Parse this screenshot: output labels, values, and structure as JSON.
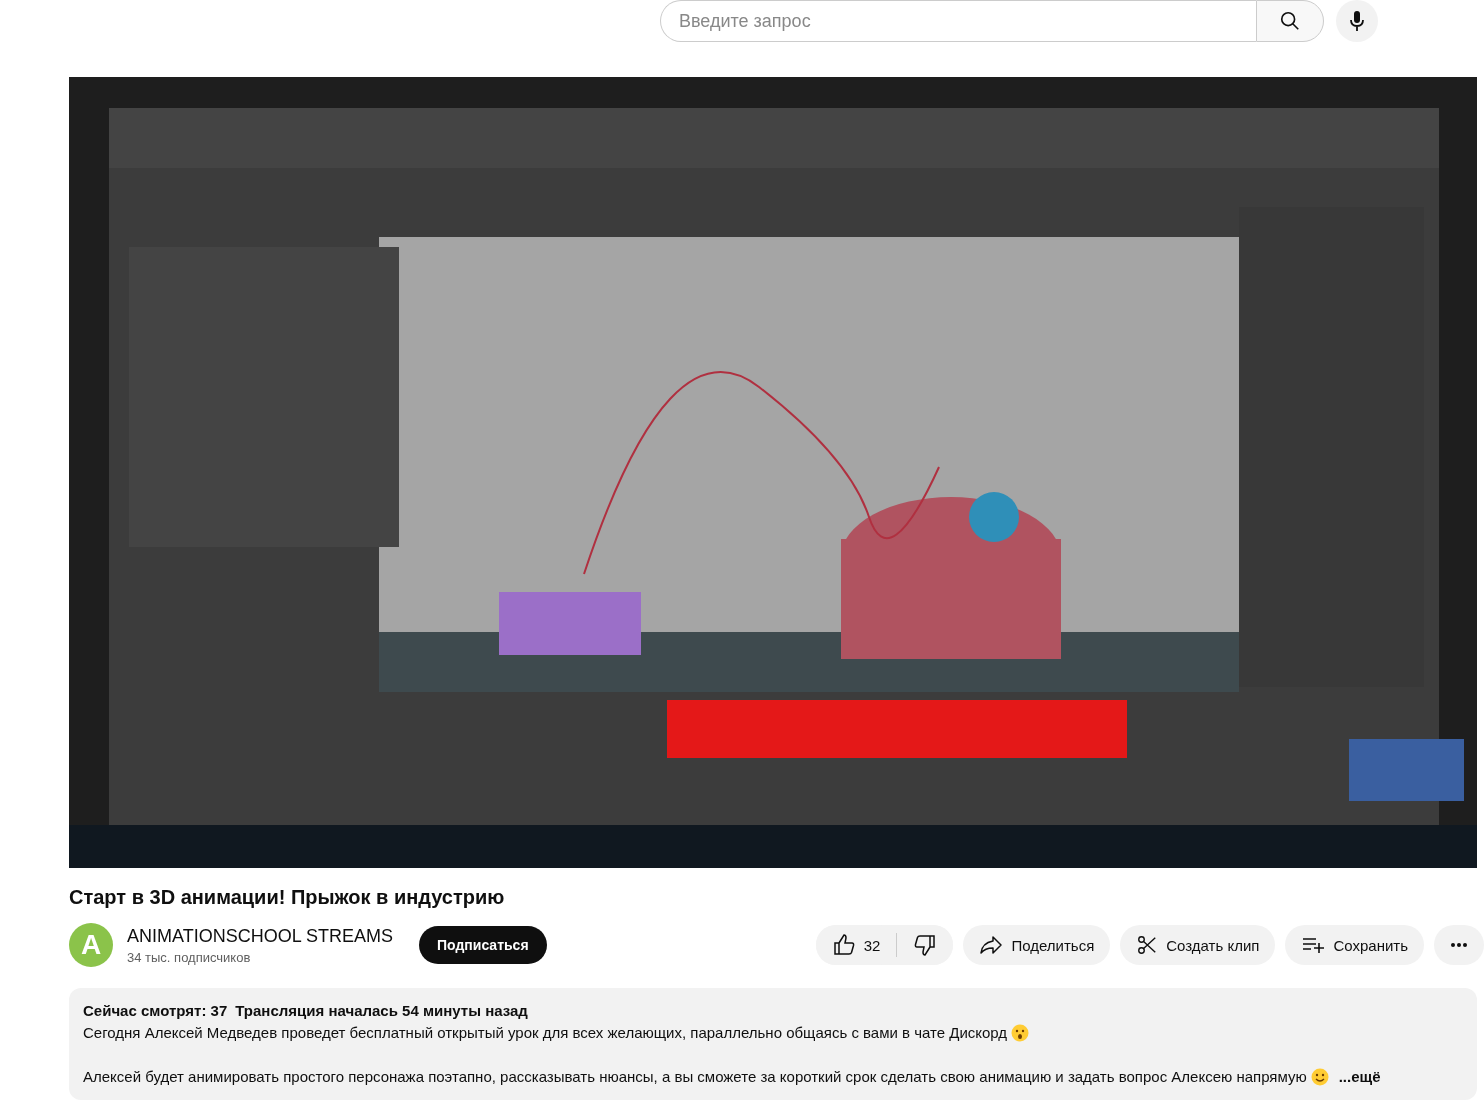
{
  "search": {
    "placeholder": "Введите запрос"
  },
  "title": "Старт в 3D анимации! Прыжок в индустрию",
  "channel": {
    "avatar_letter": "A",
    "name": "ANIMATIONSCHOOL STREAMS",
    "subscribers": "34 тыс. подписчиков",
    "subscribe_label": "Подписаться"
  },
  "actions": {
    "likes": "32",
    "share": "Поделиться",
    "clip": "Создать клип",
    "save": "Сохранить"
  },
  "description": {
    "viewers": "Сейчас смотрят: 37",
    "started": "Трансляция началась 54 минуты назад",
    "paragraphs": [
      {
        "text": "Сегодня Алексей Медведев проведет бесплатный открытый урок для всех желающих, параллельно общаясь с вами в чате Дискорд"
      },
      {
        "text": "Алексей будет анимировать простого персонажа поэтапно, рассказывать нюансы, а вы сможете за короткий срок сделать свою анимацию и задать вопрос Алексею напрямую"
      }
    ],
    "more": "...ещё"
  }
}
